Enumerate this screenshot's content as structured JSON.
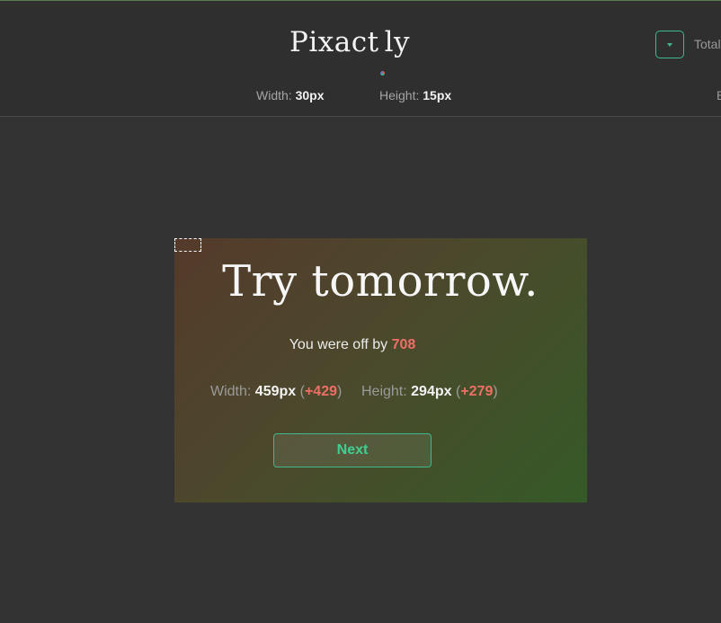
{
  "app": {
    "logo_left": "Pixact",
    "logo_right": "ly",
    "total_label": "Total",
    "best_label": "B"
  },
  "target": {
    "width_label": "Width:",
    "width_value": "30px",
    "height_label": "Height:",
    "height_value": "15px"
  },
  "result": {
    "headline": "Try tomorrow.",
    "off_by_prefix": "You were off by ",
    "off_by_value": "708",
    "width_label": "Width:",
    "width_value": "459px",
    "width_delta": "+429",
    "height_label": "Height:",
    "height_value": "294px",
    "height_delta": "+279",
    "next_label": "Next"
  },
  "colors": {
    "accent": "#3fb98a",
    "error": "#ef6f66",
    "background": "#333333"
  },
  "icons": {
    "menu": "caret-down-icon",
    "logo_dot": "multicolor-dot-icon"
  }
}
